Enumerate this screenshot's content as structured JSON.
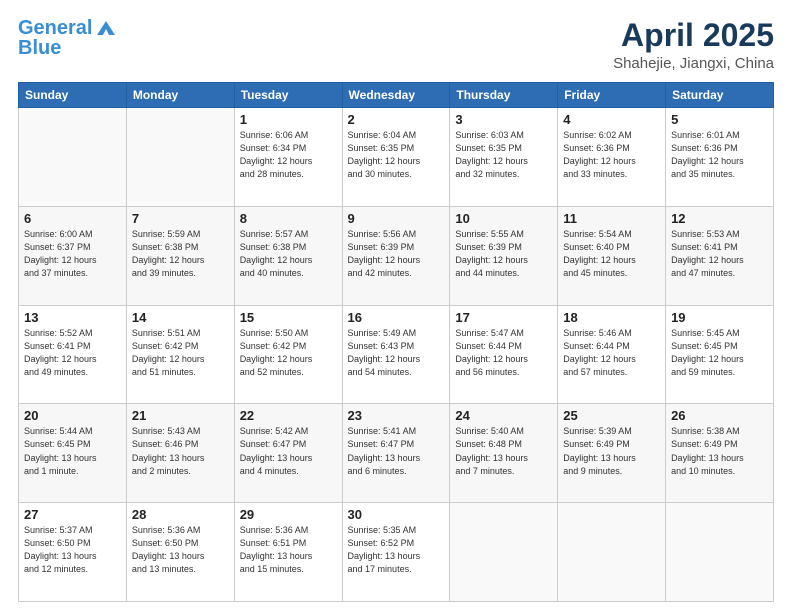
{
  "header": {
    "logo_general": "General",
    "logo_blue": "Blue",
    "month": "April 2025",
    "location": "Shahejie, Jiangxi, China"
  },
  "weekdays": [
    "Sunday",
    "Monday",
    "Tuesday",
    "Wednesday",
    "Thursday",
    "Friday",
    "Saturday"
  ],
  "weeks": [
    [
      {
        "day": "",
        "info": ""
      },
      {
        "day": "",
        "info": ""
      },
      {
        "day": "1",
        "info": "Sunrise: 6:06 AM\nSunset: 6:34 PM\nDaylight: 12 hours\nand 28 minutes."
      },
      {
        "day": "2",
        "info": "Sunrise: 6:04 AM\nSunset: 6:35 PM\nDaylight: 12 hours\nand 30 minutes."
      },
      {
        "day": "3",
        "info": "Sunrise: 6:03 AM\nSunset: 6:35 PM\nDaylight: 12 hours\nand 32 minutes."
      },
      {
        "day": "4",
        "info": "Sunrise: 6:02 AM\nSunset: 6:36 PM\nDaylight: 12 hours\nand 33 minutes."
      },
      {
        "day": "5",
        "info": "Sunrise: 6:01 AM\nSunset: 6:36 PM\nDaylight: 12 hours\nand 35 minutes."
      }
    ],
    [
      {
        "day": "6",
        "info": "Sunrise: 6:00 AM\nSunset: 6:37 PM\nDaylight: 12 hours\nand 37 minutes."
      },
      {
        "day": "7",
        "info": "Sunrise: 5:59 AM\nSunset: 6:38 PM\nDaylight: 12 hours\nand 39 minutes."
      },
      {
        "day": "8",
        "info": "Sunrise: 5:57 AM\nSunset: 6:38 PM\nDaylight: 12 hours\nand 40 minutes."
      },
      {
        "day": "9",
        "info": "Sunrise: 5:56 AM\nSunset: 6:39 PM\nDaylight: 12 hours\nand 42 minutes."
      },
      {
        "day": "10",
        "info": "Sunrise: 5:55 AM\nSunset: 6:39 PM\nDaylight: 12 hours\nand 44 minutes."
      },
      {
        "day": "11",
        "info": "Sunrise: 5:54 AM\nSunset: 6:40 PM\nDaylight: 12 hours\nand 45 minutes."
      },
      {
        "day": "12",
        "info": "Sunrise: 5:53 AM\nSunset: 6:41 PM\nDaylight: 12 hours\nand 47 minutes."
      }
    ],
    [
      {
        "day": "13",
        "info": "Sunrise: 5:52 AM\nSunset: 6:41 PM\nDaylight: 12 hours\nand 49 minutes."
      },
      {
        "day": "14",
        "info": "Sunrise: 5:51 AM\nSunset: 6:42 PM\nDaylight: 12 hours\nand 51 minutes."
      },
      {
        "day": "15",
        "info": "Sunrise: 5:50 AM\nSunset: 6:42 PM\nDaylight: 12 hours\nand 52 minutes."
      },
      {
        "day": "16",
        "info": "Sunrise: 5:49 AM\nSunset: 6:43 PM\nDaylight: 12 hours\nand 54 minutes."
      },
      {
        "day": "17",
        "info": "Sunrise: 5:47 AM\nSunset: 6:44 PM\nDaylight: 12 hours\nand 56 minutes."
      },
      {
        "day": "18",
        "info": "Sunrise: 5:46 AM\nSunset: 6:44 PM\nDaylight: 12 hours\nand 57 minutes."
      },
      {
        "day": "19",
        "info": "Sunrise: 5:45 AM\nSunset: 6:45 PM\nDaylight: 12 hours\nand 59 minutes."
      }
    ],
    [
      {
        "day": "20",
        "info": "Sunrise: 5:44 AM\nSunset: 6:45 PM\nDaylight: 13 hours\nand 1 minute."
      },
      {
        "day": "21",
        "info": "Sunrise: 5:43 AM\nSunset: 6:46 PM\nDaylight: 13 hours\nand 2 minutes."
      },
      {
        "day": "22",
        "info": "Sunrise: 5:42 AM\nSunset: 6:47 PM\nDaylight: 13 hours\nand 4 minutes."
      },
      {
        "day": "23",
        "info": "Sunrise: 5:41 AM\nSunset: 6:47 PM\nDaylight: 13 hours\nand 6 minutes."
      },
      {
        "day": "24",
        "info": "Sunrise: 5:40 AM\nSunset: 6:48 PM\nDaylight: 13 hours\nand 7 minutes."
      },
      {
        "day": "25",
        "info": "Sunrise: 5:39 AM\nSunset: 6:49 PM\nDaylight: 13 hours\nand 9 minutes."
      },
      {
        "day": "26",
        "info": "Sunrise: 5:38 AM\nSunset: 6:49 PM\nDaylight: 13 hours\nand 10 minutes."
      }
    ],
    [
      {
        "day": "27",
        "info": "Sunrise: 5:37 AM\nSunset: 6:50 PM\nDaylight: 13 hours\nand 12 minutes."
      },
      {
        "day": "28",
        "info": "Sunrise: 5:36 AM\nSunset: 6:50 PM\nDaylight: 13 hours\nand 13 minutes."
      },
      {
        "day": "29",
        "info": "Sunrise: 5:36 AM\nSunset: 6:51 PM\nDaylight: 13 hours\nand 15 minutes."
      },
      {
        "day": "30",
        "info": "Sunrise: 5:35 AM\nSunset: 6:52 PM\nDaylight: 13 hours\nand 17 minutes."
      },
      {
        "day": "",
        "info": ""
      },
      {
        "day": "",
        "info": ""
      },
      {
        "day": "",
        "info": ""
      }
    ]
  ]
}
